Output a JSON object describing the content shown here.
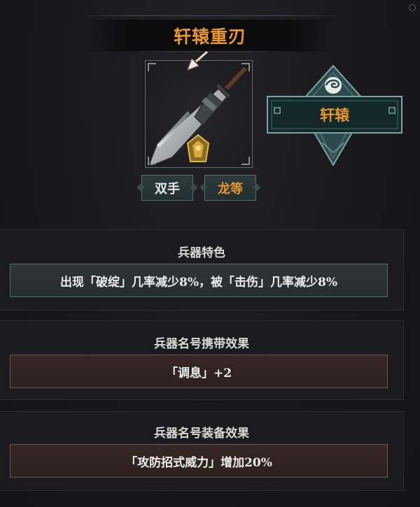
{
  "weapon": {
    "name": "轩辕重刃",
    "series_label": "轩辕",
    "hand_tag": "双手",
    "grade_tag": "龙等"
  },
  "sections": [
    {
      "title": "兵器特色",
      "content": "出现「破绽」几率减少8%，被「击伤」几率减少8%",
      "style": "teal"
    },
    {
      "title": "兵器名号携带效果",
      "content": "「调息」+2",
      "style": "brown"
    },
    {
      "title": "兵器名号装备效果",
      "content": "「攻防招式威力」增加20%",
      "style": "brown"
    }
  ],
  "colors": {
    "accent_orange": "#e8962e",
    "teal_panel": "#2c3537",
    "brown_panel": "#352724",
    "background": "#17171a"
  },
  "icons": {
    "weapon": "greatsword-icon",
    "cursor": "pointer-arrow-icon",
    "rank_badge": "gold-crest-icon",
    "series_emblem": "swirl-diamond-icon"
  }
}
